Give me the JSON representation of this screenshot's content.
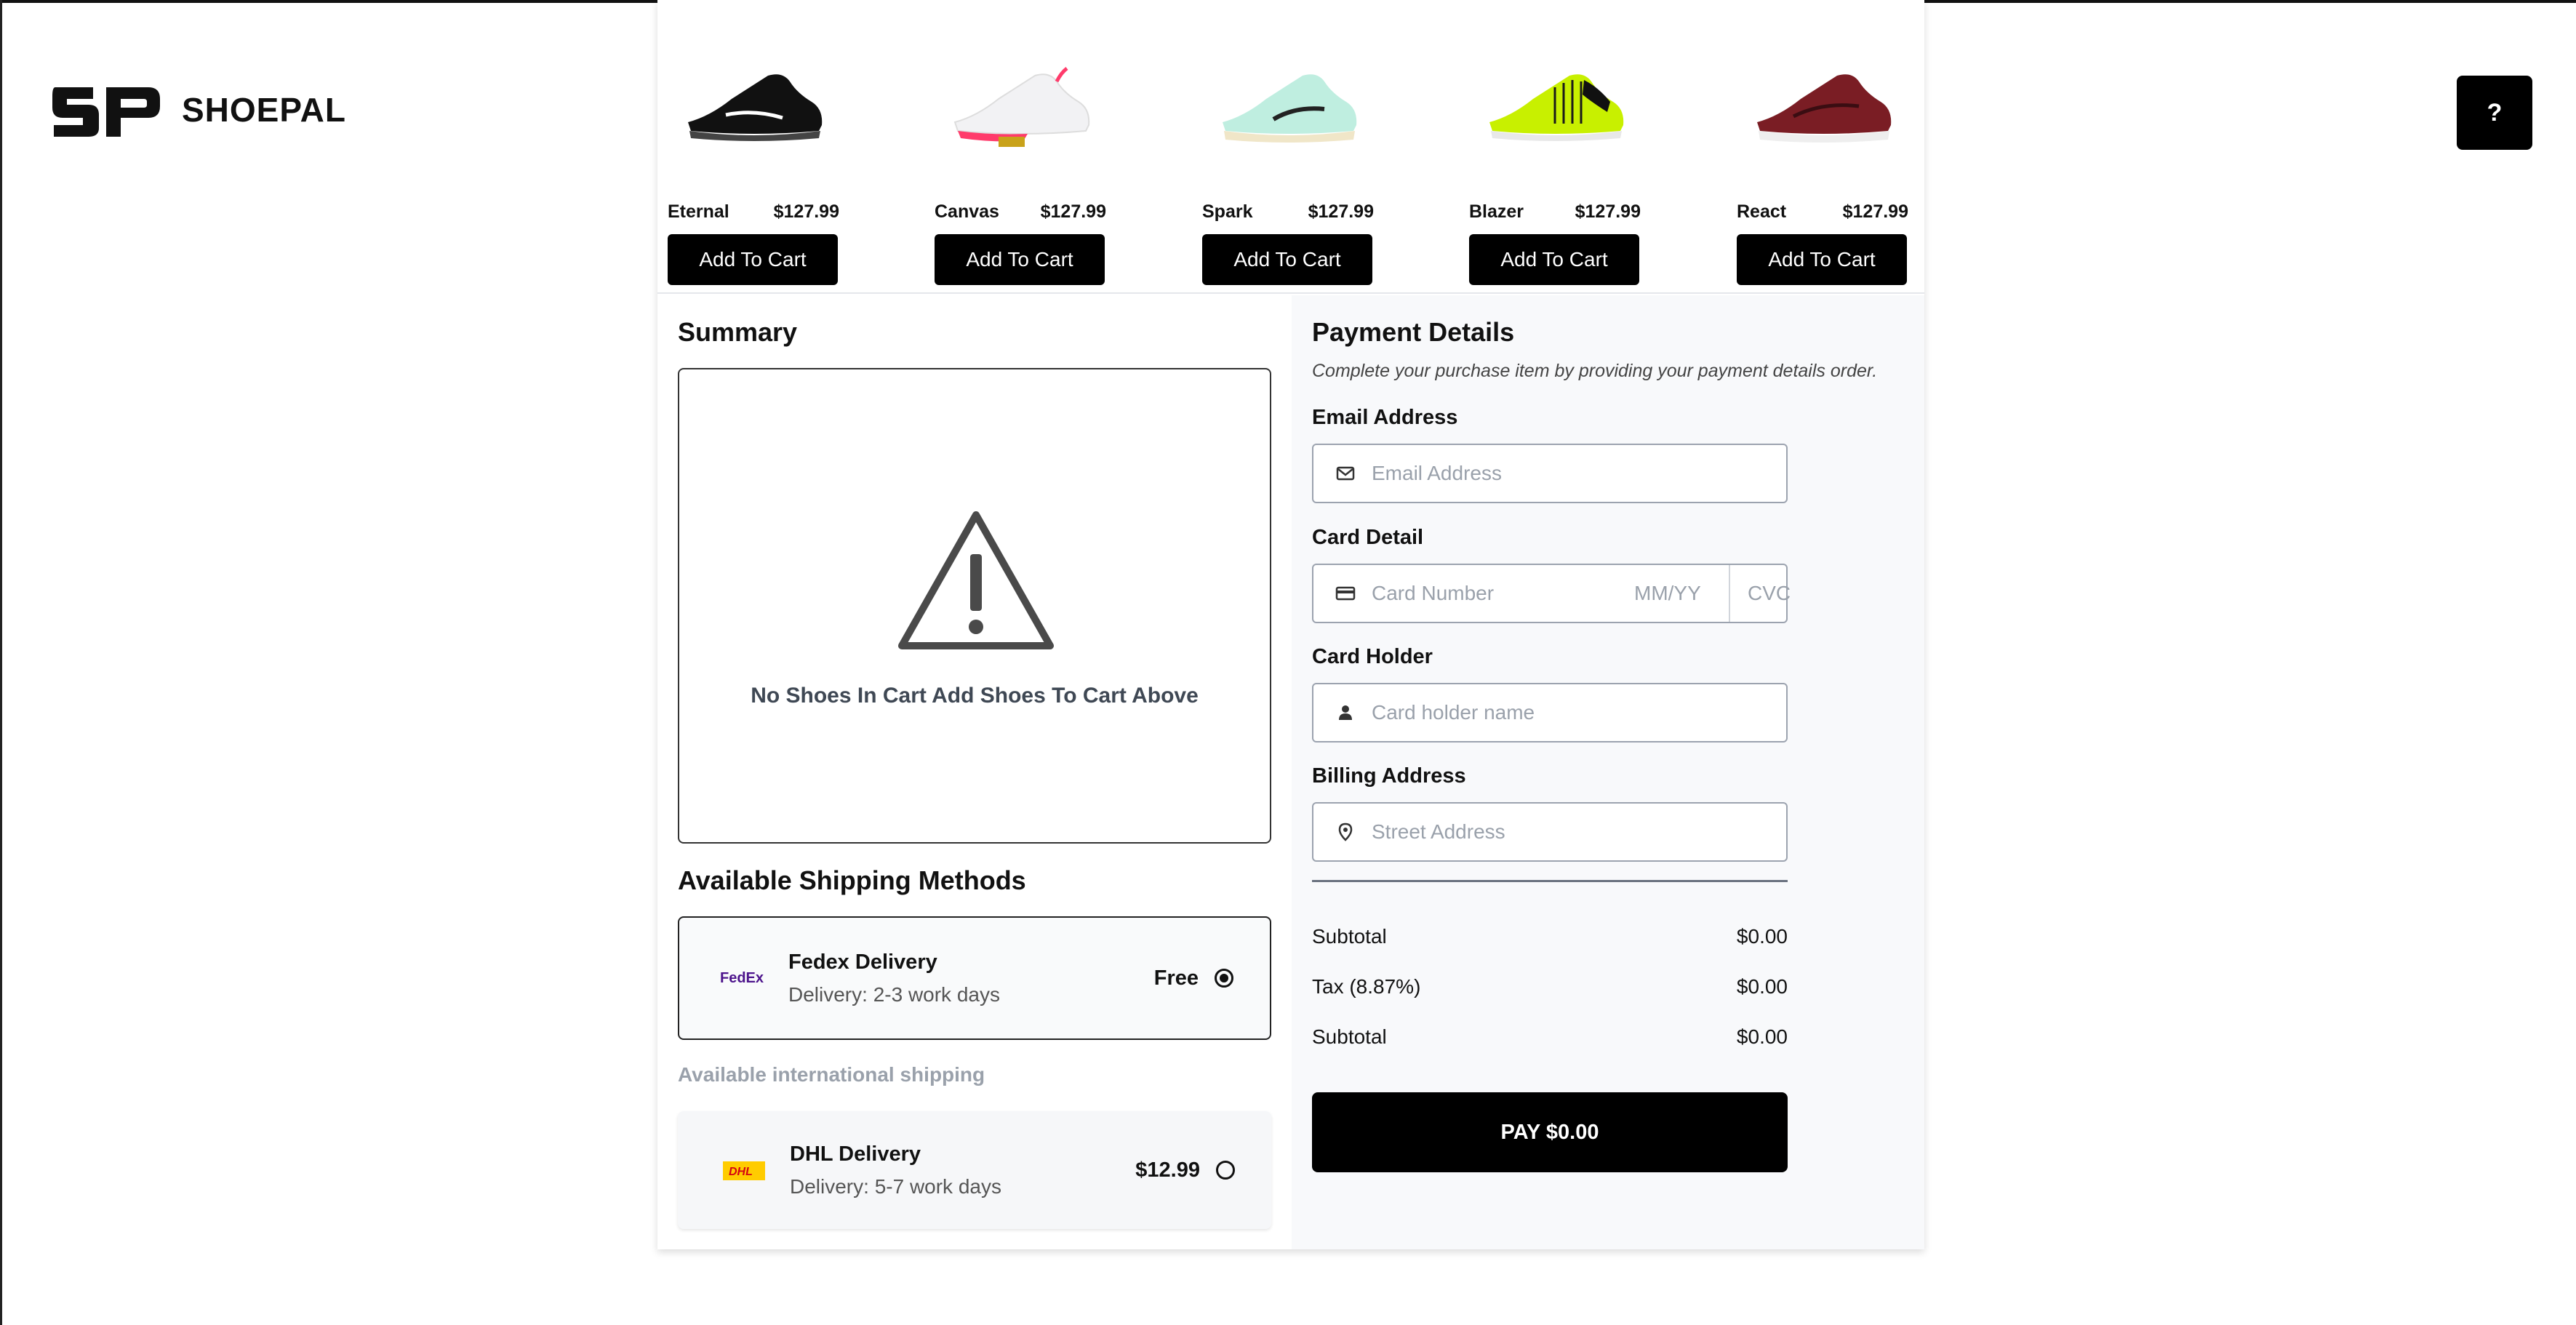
{
  "brand": {
    "name": "SHOEPAL",
    "mark": "SP"
  },
  "help": {
    "label": "?"
  },
  "products": [
    {
      "name": "Eternal",
      "price": "$127.99",
      "button": "Add To Cart",
      "color": "#111111"
    },
    {
      "name": "Canvas",
      "price": "$127.99",
      "button": "Add To Cart",
      "color": "#f2f2f4"
    },
    {
      "name": "Spark",
      "price": "$127.99",
      "button": "Add To Cart",
      "color": "#bfeee0"
    },
    {
      "name": "Blazer",
      "price": "$127.99",
      "button": "Add To Cart",
      "color": "#c8f000"
    },
    {
      "name": "React",
      "price": "$127.99",
      "button": "Add To Cart",
      "color": "#7a1d24"
    }
  ],
  "summary": {
    "title": "Summary",
    "empty_message": "No Shoes In Cart Add Shoes To Cart Above"
  },
  "shipping": {
    "title": "Available Shipping Methods",
    "intl_label": "Available international shipping",
    "methods": [
      {
        "carrier": "FedEx",
        "name": "Fedex Delivery",
        "days": "Delivery: 2-3 work days",
        "price": "Free",
        "selected": true
      },
      {
        "carrier": "DHL",
        "name": "DHL Delivery",
        "days": "Delivery: 5-7 work days",
        "price": "$12.99",
        "selected": false
      }
    ]
  },
  "payment": {
    "title": "Payment Details",
    "description": "Complete your purchase item by providing your payment details order.",
    "email": {
      "label": "Email Address",
      "placeholder": "Email Address",
      "value": ""
    },
    "card": {
      "label": "Card Detail",
      "number_placeholder": "Card Number",
      "expiry_placeholder": "MM/YY",
      "cvc_placeholder": "CVC"
    },
    "holder": {
      "label": "Card Holder",
      "placeholder": "Card holder name"
    },
    "billing": {
      "label": "Billing Address",
      "placeholder": "Street Address"
    },
    "totals": [
      {
        "label": "Subtotal",
        "value": "$0.00"
      },
      {
        "label": "Tax (8.87%)",
        "value": "$0.00"
      },
      {
        "label": "Subtotal",
        "value": "$0.00"
      }
    ],
    "pay_button": "PAY $0.00"
  }
}
